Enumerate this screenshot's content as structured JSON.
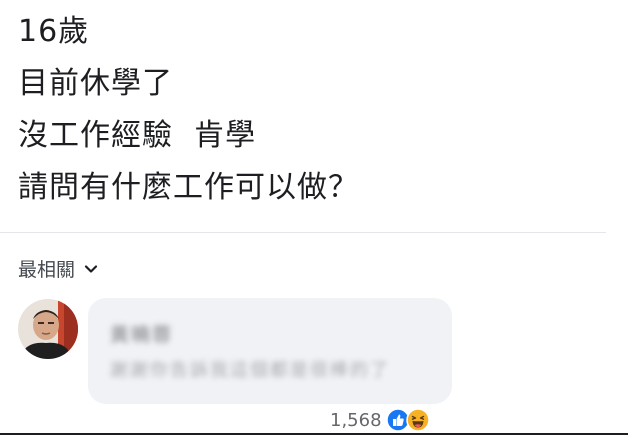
{
  "post": {
    "lines": [
      "16歲",
      "目前休學了",
      "沒工作經驗  肯學",
      "請問有什麼工作可以做？"
    ]
  },
  "comments_sort": {
    "label": "最相關",
    "icon": "chevron-down-icon"
  },
  "comment": {
    "author_name": "黃曉蓉",
    "text": "謝謝你告訴我這個都是很棒的了",
    "blurred": true,
    "avatar_icon": "user-avatar",
    "reactions": {
      "count": "1,568",
      "types": [
        "like-icon",
        "haha-icon"
      ],
      "like_color": "#1877f2",
      "haha_color": "#f7b125"
    }
  },
  "colors": {
    "text": "#1c1e21",
    "secondary_text": "#65676b",
    "bubble_bg": "#f0f2f5",
    "divider": "#e4e6eb"
  }
}
